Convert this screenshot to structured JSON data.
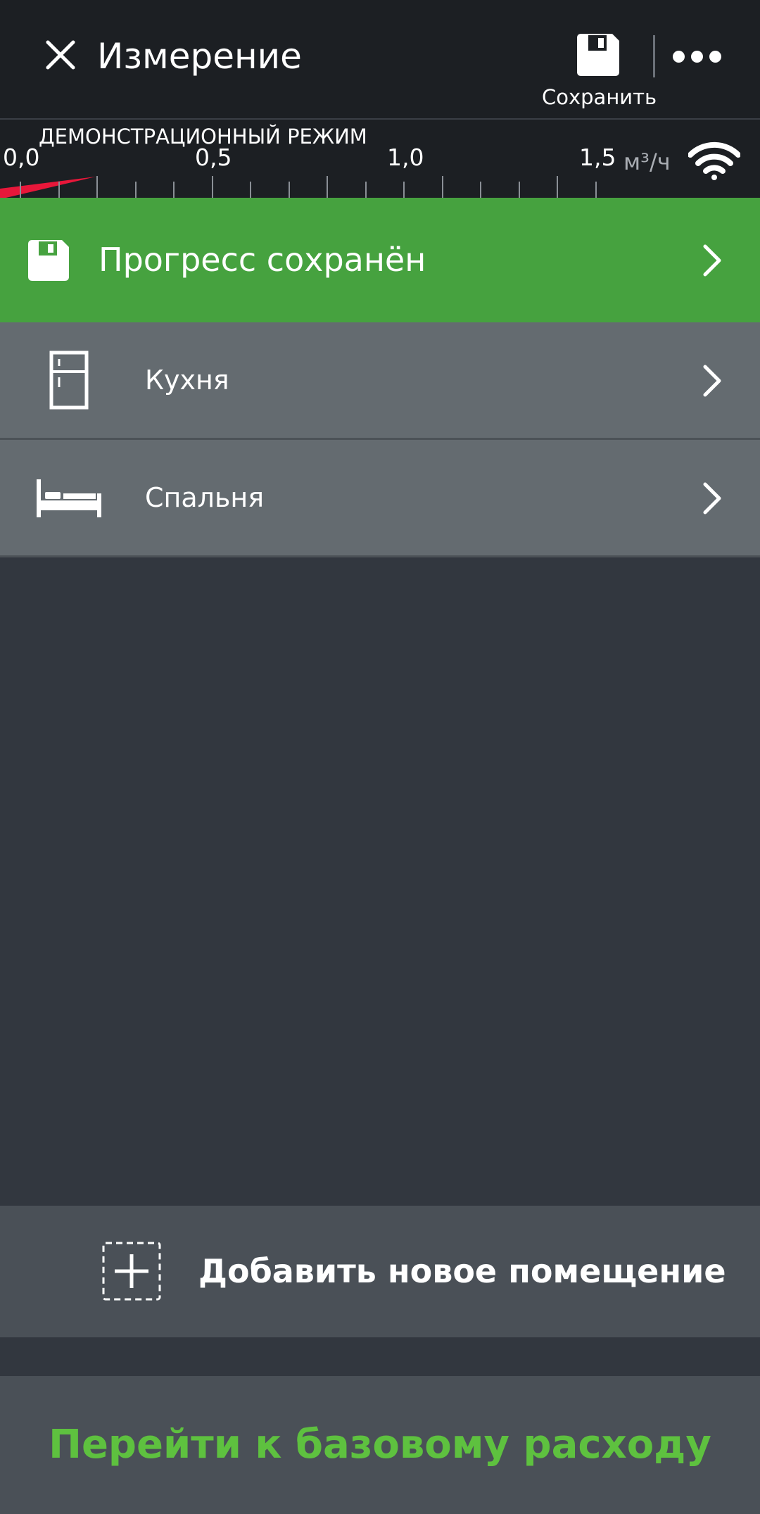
{
  "header": {
    "title": "Измерение",
    "save_label": "Сохранить",
    "icons": {
      "close": "close-icon",
      "save": "floppy-disk-icon",
      "more": "more-dots-icon"
    }
  },
  "meter": {
    "mode_label": "ДЕМОНСТРАЦИОННЫЙ РЕЖИМ",
    "scale_labels": [
      "0,0",
      "0,5",
      "1,0",
      "1,5"
    ],
    "unit": "м³/ч",
    "indicator_color": "#e8173a",
    "connection_icon": "wifi-icon"
  },
  "status_row": {
    "label": "Прогресс сохранён",
    "icon": "floppy-disk-icon",
    "background": "#46a23f"
  },
  "rooms": [
    {
      "label": "Кухня",
      "icon": "fridge-icon"
    },
    {
      "label": "Спальня",
      "icon": "bed-icon"
    }
  ],
  "actions": {
    "add_room_label": "Добавить новое помещение",
    "add_room_icon": "add-dashed-icon",
    "baseline_label": "Перейти к базовому расходу",
    "baseline_color": "#5ec13f"
  }
}
